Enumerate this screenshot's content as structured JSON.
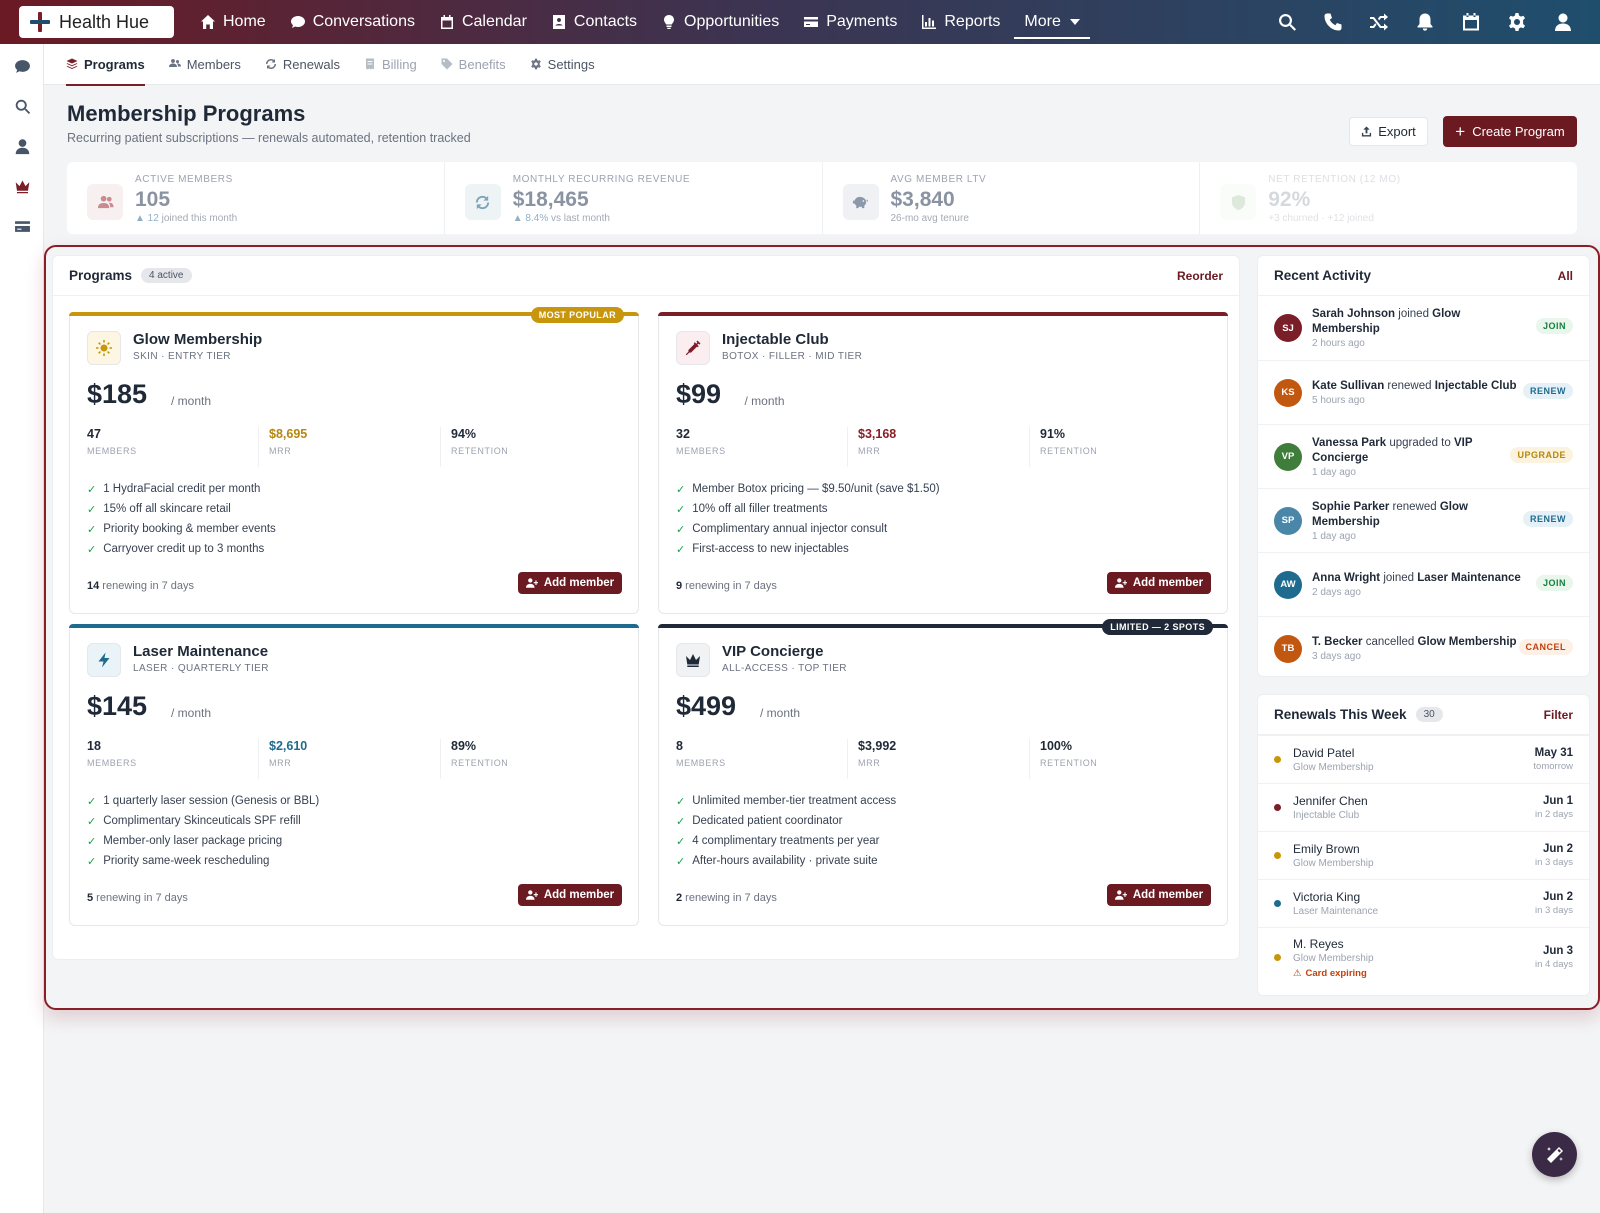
{
  "app": {
    "brand": "Health Hue"
  },
  "nav": {
    "items": [
      {
        "id": "home",
        "label": "Home"
      },
      {
        "id": "conversations",
        "label": "Conversations"
      },
      {
        "id": "calendar",
        "label": "Calendar"
      },
      {
        "id": "contacts",
        "label": "Contacts"
      },
      {
        "id": "opportunities",
        "label": "Opportunities"
      },
      {
        "id": "payments",
        "label": "Payments"
      },
      {
        "id": "reports",
        "label": "Reports"
      }
    ],
    "more_label": "More"
  },
  "subtabs": [
    {
      "label": "Programs",
      "state": "active"
    },
    {
      "label": "Members",
      "state": "normal"
    },
    {
      "label": "Renewals",
      "state": "normal"
    },
    {
      "label": "Billing",
      "state": "disabled"
    },
    {
      "label": "Benefits",
      "state": "disabled"
    },
    {
      "label": "Settings",
      "state": "normal"
    }
  ],
  "header": {
    "title": "Membership Programs",
    "subtitle": "Recurring patient subscriptions — renewals automated, retention tracked",
    "export_label": "Export",
    "create_label": "Create Program"
  },
  "kpis": [
    {
      "label": "Active Members",
      "value": "105",
      "foot_strong": "▲ 12",
      "foot": " joined this month",
      "icon": "users-icon",
      "color": "#c98b90"
    },
    {
      "label": "Monthly Recurring Revenue",
      "value": "$18,465",
      "foot_strong": "▲ 8.4%",
      "foot": " vs last month",
      "icon": "refresh-icon",
      "color": "#7fa4b8"
    },
    {
      "label": "Avg Member LTV",
      "value": "$3,840",
      "foot_strong": "",
      "foot": "26-mo avg tenure",
      "icon": "piggy-icon",
      "color": "#8a98aa"
    },
    {
      "label": "Net Retention (12 mo)",
      "value": "92%",
      "foot_strong": "",
      "foot": "+3 churned · +12 joined",
      "icon": "shield-icon",
      "color": "#9fc29a"
    }
  ],
  "programs_panel": {
    "title": "Programs",
    "count_label": "4 active",
    "reorder_label": "Reorder"
  },
  "programs": [
    {
      "name": "Glow Membership",
      "tier": "SKIN · ENTRY TIER",
      "price": "$185",
      "period": "/ month",
      "members": "47",
      "mrr": "$8,695",
      "retention": "94%",
      "mrr_color": "#b7860b",
      "accent": "#c8960c",
      "ribbon": "MOST POPULAR",
      "ribbon_color": "#c8960c",
      "icon": "sun-icon",
      "icon_bg": "#fdf6e3",
      "features": [
        "1 HydraFacial credit per month",
        "15% off all skincare retail",
        "Priority booking & member events",
        "Carryover credit up to 3 months"
      ],
      "renewing_count": "14",
      "renewing_text": " renewing in 7 days"
    },
    {
      "name": "Injectable Club",
      "tier": "BOTOX · FILLER · MID TIER",
      "price": "$99",
      "period": "/ month",
      "members": "32",
      "mrr": "$3,168",
      "retention": "91%",
      "mrr_color": "#8a1e26",
      "accent": "#7a1e28",
      "ribbon": "",
      "ribbon_color": "",
      "icon": "syringe-icon",
      "icon_bg": "#fbeef0",
      "features": [
        "Member Botox pricing — $9.50/unit (save $1.50)",
        "10% off all filler treatments",
        "Complimentary annual injector consult",
        "First-access to new injectables"
      ],
      "renewing_count": "9",
      "renewing_text": " renewing in 7 days"
    },
    {
      "name": "Laser Maintenance",
      "tier": "LASER · QUARTERLY TIER",
      "price": "$145",
      "period": "/ month",
      "members": "18",
      "mrr": "$2,610",
      "retention": "89%",
      "mrr_color": "#1f6b8f",
      "accent": "#1f6b8f",
      "ribbon": "",
      "ribbon_color": "",
      "icon": "bolt-icon",
      "icon_bg": "#eaf3f8",
      "features": [
        "1 quarterly laser session (Genesis or BBL)",
        "Complimentary Skinceuticals SPF refill",
        "Member-only laser package pricing",
        "Priority same-week rescheduling"
      ],
      "renewing_count": "5",
      "renewing_text": " renewing in 7 days"
    },
    {
      "name": "VIP Concierge",
      "tier": "ALL-ACCESS · TOP TIER",
      "price": "$499",
      "period": "/ month",
      "members": "8",
      "mrr": "$3,992",
      "retention": "100%",
      "mrr_color": "#1f2937",
      "accent": "#1f2937",
      "ribbon": "LIMITED — 2 SPOTS",
      "ribbon_color": "#1f2937",
      "icon": "crown-icon",
      "icon_bg": "#f1f2f4",
      "features": [
        "Unlimited member-tier treatment access",
        "Dedicated patient coordinator",
        "4 complimentary treatments per year",
        "After-hours availability · private suite"
      ],
      "renewing_count": "2",
      "renewing_text": " renewing in 7 days"
    }
  ],
  "stat_labels": {
    "members": "MEMBERS",
    "mrr": "MRR",
    "retention": "RETENTION"
  },
  "add_member_label": "Add member",
  "activity": {
    "title": "Recent Activity",
    "all_label": "All",
    "items": [
      {
        "initials": "SJ",
        "color": "#7a1e28",
        "name": "Sarah Johnson",
        "verb": " joined ",
        "program": "Glow Membership",
        "time": "2 hours ago",
        "badge": "JOIN",
        "badge_fg": "#15803d",
        "badge_bg": "#e8f6ec"
      },
      {
        "initials": "KS",
        "color": "#c2570f",
        "name": "Kate Sullivan",
        "verb": " renewed ",
        "program": "Injectable Club",
        "time": "5 hours ago",
        "badge": "RENEW",
        "badge_fg": "#1f6b8f",
        "badge_bg": "#e6f1f7"
      },
      {
        "initials": "VP",
        "color": "#3f7d3a",
        "name": "Vanessa Park",
        "verb": " upgraded to ",
        "program": "VIP Concierge",
        "time": "1 day ago",
        "badge": "UPGRADE",
        "badge_fg": "#b7860b",
        "badge_bg": "#fbf3dd"
      },
      {
        "initials": "SP",
        "color": "#4a86a8",
        "name": "Sophie Parker",
        "verb": " renewed ",
        "program": "Glow Membership",
        "time": "1 day ago",
        "badge": "RENEW",
        "badge_fg": "#1f6b8f",
        "badge_bg": "#e6f1f7"
      },
      {
        "initials": "AW",
        "color": "#1f6b8f",
        "name": "Anna Wright",
        "verb": " joined ",
        "program": "Laser Maintenance",
        "time": "2 days ago",
        "badge": "JOIN",
        "badge_fg": "#15803d",
        "badge_bg": "#e8f6ec"
      },
      {
        "initials": "TB",
        "color": "#c2570f",
        "name": "T. Becker",
        "verb": " cancelled ",
        "program": "Glow Membership",
        "time": "3 days ago",
        "badge": "CANCEL",
        "badge_fg": "#c2410c",
        "badge_bg": "#fdf0e6"
      }
    ]
  },
  "renewals": {
    "title": "Renewals This Week",
    "count": "30",
    "filter_label": "Filter",
    "items": [
      {
        "name": "David Patel",
        "program": "Glow Membership",
        "date": "May 31",
        "rel": "tomorrow",
        "dot": "#c8960c",
        "warn": ""
      },
      {
        "name": "Jennifer Chen",
        "program": "Injectable Club",
        "date": "Jun 1",
        "rel": "in 2 days",
        "dot": "#7a1e28",
        "warn": ""
      },
      {
        "name": "Emily Brown",
        "program": "Glow Membership",
        "date": "Jun 2",
        "rel": "in 3 days",
        "dot": "#c8960c",
        "warn": ""
      },
      {
        "name": "Victoria King",
        "program": "Laser Maintenance",
        "date": "Jun 2",
        "rel": "in 3 days",
        "dot": "#1f6b8f",
        "warn": ""
      },
      {
        "name": "M. Reyes",
        "program": "Glow Membership",
        "date": "Jun 3",
        "rel": "in 4 days",
        "dot": "#c8960c",
        "warn": "Card expiring"
      }
    ]
  }
}
